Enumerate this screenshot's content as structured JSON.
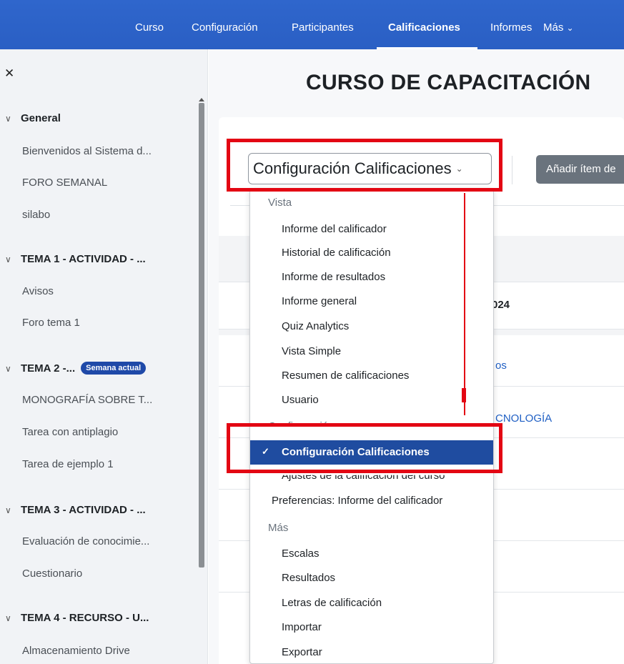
{
  "topnav": {
    "items": [
      "Curso",
      "Configuración",
      "Participantes",
      "Calificaciones",
      "Informes",
      "Más"
    ],
    "more_caret": "⌄",
    "active": "Calificaciones",
    "bg_color": "#2d63c8"
  },
  "sidebar": {
    "close_icon": "✕",
    "sections": [
      {
        "title": "General",
        "items": [
          "Bienvenidos al Sistema d...",
          "FORO SEMANAL",
          "silabo"
        ]
      },
      {
        "title": "TEMA 1 - ACTIVIDAD - ...",
        "items": [
          "Avisos",
          "Foro tema 1"
        ]
      },
      {
        "title": "TEMA 2 -...",
        "badge": "Semana actual",
        "items": [
          "MONOGRAFÍA SOBRE T...",
          "Tarea con antiplagio",
          "Tarea de ejemplo 1"
        ]
      },
      {
        "title": "TEMA 3 - ACTIVIDAD - ...",
        "items": [
          "Evaluación de conocimie...",
          "Cuestionario"
        ]
      },
      {
        "title": "TEMA 4 - RECURSO - U...",
        "items": [
          "Almacenamiento Drive"
        ]
      }
    ]
  },
  "main": {
    "title": "CURSO DE CAPACITACIÓN",
    "select_value": "Configuración Calificaciones",
    "add_button": "Añadir ítem de",
    "table_fragments": [
      "024",
      "os",
      "CNOLOGÍA"
    ]
  },
  "menu": {
    "groups": [
      {
        "header": "Vista",
        "items": [
          "Informe del calificador",
          "Historial de calificación",
          "Informe de resultados",
          "Informe general",
          "Quiz Analytics",
          "Vista Simple",
          "Resumen de calificaciones",
          "Usuario"
        ]
      },
      {
        "header": "Configuración",
        "selected": "Configuración Calificaciones",
        "items": [
          "Ajustes de la calificación del curso",
          "Preferencias: Informe del calificador"
        ]
      },
      {
        "header": "Más",
        "items": [
          "Escalas",
          "Resultados",
          "Letras de calificación",
          "Importar",
          "Exportar"
        ]
      }
    ],
    "check_icon": "✓",
    "selected_color": "#1f4ca0"
  },
  "annotation_color": "#e30613"
}
